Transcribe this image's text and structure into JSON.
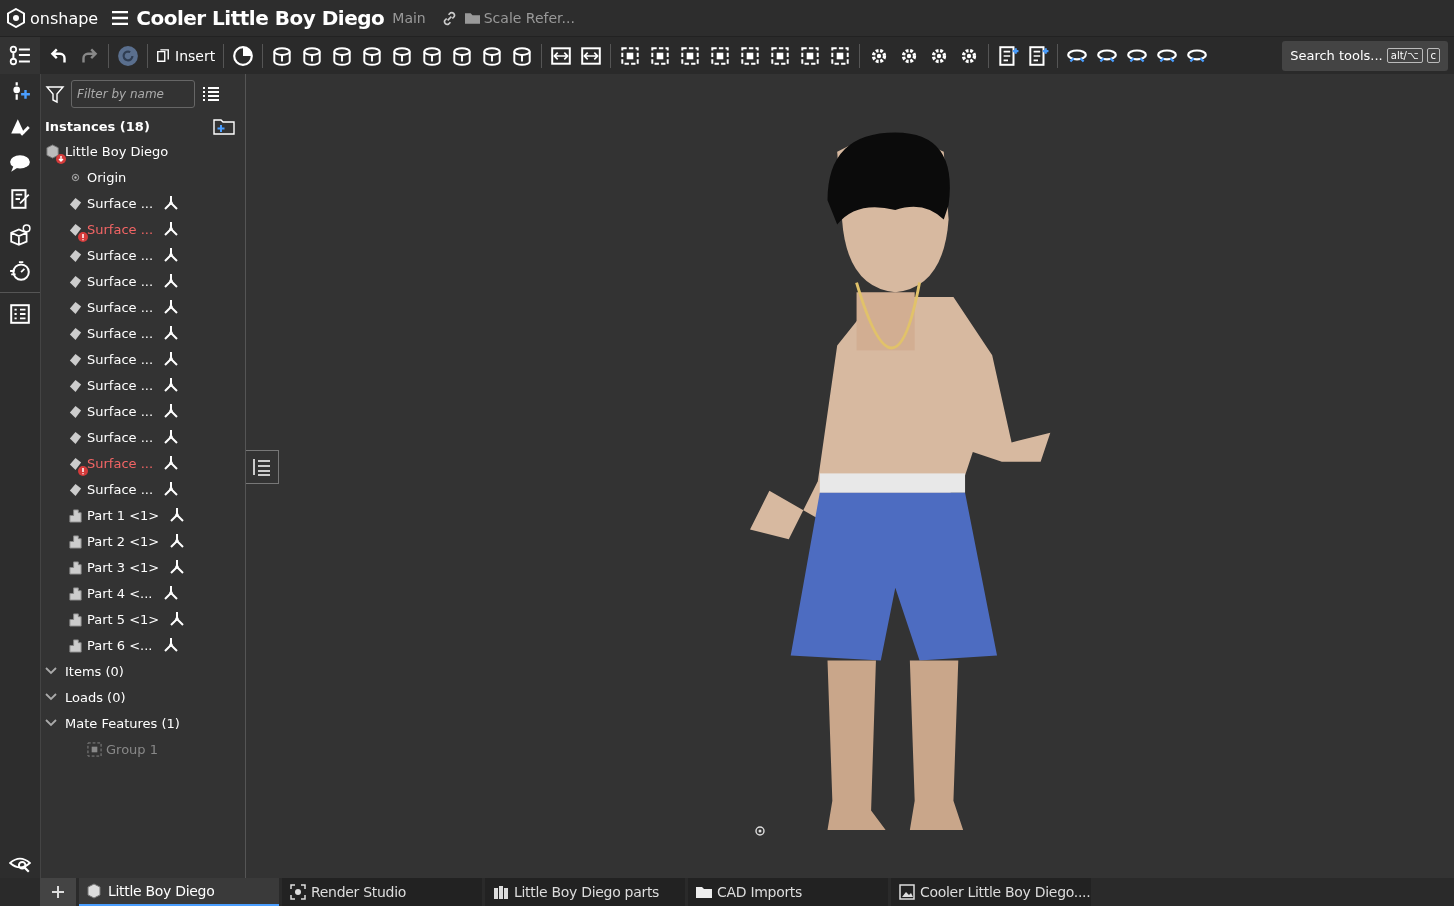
{
  "header": {
    "logo": "onshape",
    "title": "Cooler Little Boy Diego",
    "branch": "Main",
    "folder": "Scale Refer..."
  },
  "toolbar": {
    "insert": "Insert",
    "search": "Search tools...",
    "shortcut_1": "alt/⌥",
    "shortcut_2": "c"
  },
  "panel": {
    "filter_placeholder": "Filter by name",
    "instances_title": "Instances (18)",
    "root": {
      "label": "Little Boy Diego",
      "kind": "assembly",
      "error": true
    },
    "instances": [
      {
        "label": "Origin",
        "kind": "origin",
        "error": false
      },
      {
        "label": "Surface ...",
        "kind": "surface",
        "error": false
      },
      {
        "label": "Surface ...",
        "kind": "surface",
        "error": true
      },
      {
        "label": "Surface ...",
        "kind": "surface",
        "error": false
      },
      {
        "label": "Surface ...",
        "kind": "surface",
        "error": false
      },
      {
        "label": "Surface ...",
        "kind": "surface",
        "error": false
      },
      {
        "label": "Surface ...",
        "kind": "surface",
        "error": false
      },
      {
        "label": "Surface ...",
        "kind": "surface",
        "error": false
      },
      {
        "label": "Surface ...",
        "kind": "surface",
        "error": false
      },
      {
        "label": "Surface ...",
        "kind": "surface",
        "error": false
      },
      {
        "label": "Surface ...",
        "kind": "surface",
        "error": false
      },
      {
        "label": "Surface ...",
        "kind": "surface",
        "error": true
      },
      {
        "label": "Surface ...",
        "kind": "surface",
        "error": false
      },
      {
        "label": "Part 1 <1>",
        "kind": "part",
        "error": false
      },
      {
        "label": "Part 2 <1>",
        "kind": "part",
        "error": false
      },
      {
        "label": "Part 3 <1>",
        "kind": "part",
        "error": false
      },
      {
        "label": "Part 4 <...",
        "kind": "part",
        "error": false
      },
      {
        "label": "Part 5 <1>",
        "kind": "part",
        "error": false
      },
      {
        "label": "Part 6 <...",
        "kind": "part",
        "error": false
      }
    ],
    "sections": [
      {
        "label": "Items (0)",
        "expanded": true
      },
      {
        "label": "Loads (0)",
        "expanded": true
      },
      {
        "label": "Mate Features (1)",
        "expanded": true,
        "children": [
          {
            "label": "Group 1",
            "disabled": true
          }
        ]
      }
    ]
  },
  "tabs": [
    {
      "label": "Little Boy Diego",
      "kind": "assembly",
      "selected": true
    },
    {
      "label": "Render Studio",
      "kind": "render",
      "selected": false
    },
    {
      "label": "Little Boy Diego parts",
      "kind": "parts",
      "selected": false
    },
    {
      "label": "CAD Imports",
      "kind": "folder",
      "selected": false
    },
    {
      "label": "Cooler Little Boy Diego....",
      "kind": "image",
      "selected": false
    }
  ]
}
